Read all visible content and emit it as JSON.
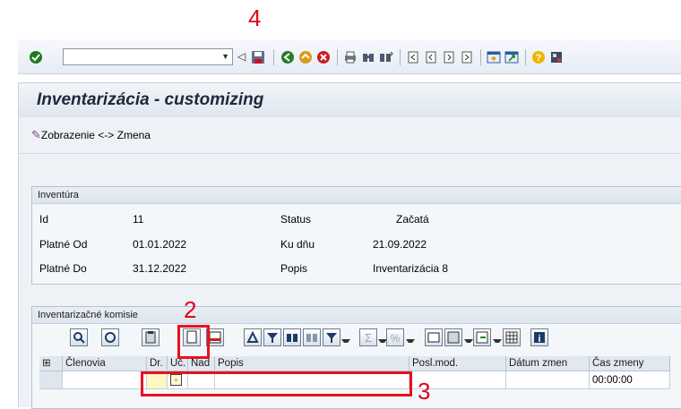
{
  "annotations": [
    "4",
    "2",
    "3"
  ],
  "toolbar": {
    "command_field_value": "",
    "icons": [
      "enter-icon",
      "save-icon",
      "back-icon",
      "exit-icon",
      "cancel-icon",
      "print-icon",
      "find-icon",
      "find-next-icon",
      "first-page-icon",
      "previous-page-icon",
      "next-page-icon",
      "last-page-icon",
      "new-session-icon",
      "shortcut-icon",
      "help-icon",
      "customize-layout-icon"
    ]
  },
  "header": {
    "title": "Inventarizácia - customizing",
    "mode_button": "Zobrazenie <-> Zmena"
  },
  "inventura": {
    "group_title": "Inventúra",
    "id_label": "Id",
    "id_value": "11",
    "platne_od_label": "Platné Od",
    "platne_od_value": "01.01.2022",
    "platne_do_label": "Platné Do",
    "platne_do_value": "31.12.2022",
    "status_label": "Status",
    "status_value": "Začatá",
    "ku_dnu_label": "Ku dňu",
    "ku_dnu_value": "21.09.2022",
    "popis_label": "Popis",
    "popis_value": "Inventarizácia 8"
  },
  "komisie": {
    "group_title": "Inventarizačné komisie",
    "columns": [
      "Členovia",
      "Dr.",
      "Uč.",
      "Nad",
      "Popis",
      "Posl.mod.",
      "Dátum zmen",
      "Čas zmeny"
    ],
    "row": {
      "clenovia": "",
      "dr": "",
      "uc": "",
      "nad": "",
      "popis": "",
      "posl_mod": "",
      "datum_zmen": "",
      "cas_zmeny": "00:00:00"
    }
  }
}
